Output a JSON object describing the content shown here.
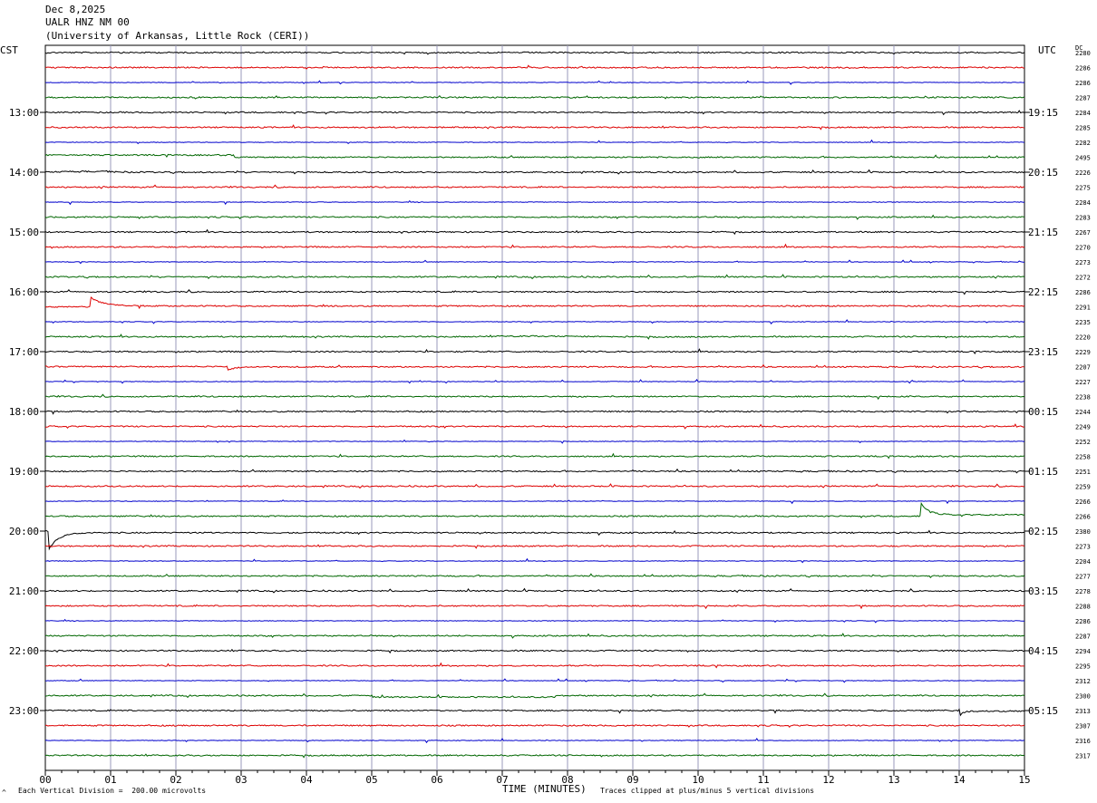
{
  "header": {
    "date": "Dec 8,2025",
    "station": "UALR HNZ NM 00",
    "institution": "(University of Arkansas, Little Rock (CERI))"
  },
  "labels": {
    "left_tz": "CST",
    "right_tz": "UTC",
    "dc_label": "DC",
    "xlabel": "TIME (MINUTES)",
    "scale_note": "Each Vertical Division =  200.00 microvolts",
    "clip_note": "Traces clipped at plus/minus 5 vertical divisions",
    "corner_mark": "^"
  },
  "colors": {
    "trace_cycle": [
      "#000000",
      "#dd0000",
      "#0000cc",
      "#006600"
    ],
    "grid_vertical": "#9999bb"
  },
  "chart_data": {
    "type": "line",
    "title": "",
    "x_range": [
      0,
      15
    ],
    "x_ticks": [
      "00",
      "01",
      "02",
      "03",
      "04",
      "05",
      "06",
      "07",
      "08",
      "09",
      "10",
      "11",
      "12",
      "13",
      "14",
      "15"
    ],
    "rows_per_hour": 4,
    "left_hour_labels": [
      "13:00",
      "14:00",
      "15:00",
      "16:00",
      "17:00",
      "18:00",
      "19:00",
      "20:00",
      "21:00",
      "22:00",
      "23:00"
    ],
    "right_hour_labels": [
      "19:15",
      "20:15",
      "21:15",
      "22:15",
      "23:15",
      "00:15",
      "01:15",
      "02:15",
      "03:15",
      "04:15",
      "05:15"
    ],
    "first_labeled_row": 4,
    "dc_values": [
      "2280",
      "2286",
      "2286",
      "2287",
      "2284",
      "2285",
      "2282",
      "2495",
      "2226",
      "2275",
      "2284",
      "2283",
      "2267",
      "2270",
      "2273",
      "2272",
      "2286",
      "2291",
      "2235",
      "2220",
      "2229",
      "2207",
      "2227",
      "2238",
      "2244",
      "2249",
      "2252",
      "2258",
      "2251",
      "2259",
      "2266",
      "2266",
      "2380",
      "2273",
      "2204",
      "2277",
      "2278",
      "2288",
      "2286",
      "2287",
      "2294",
      "2295",
      "2312",
      "2300",
      "2313",
      "2307",
      "2316",
      "2317"
    ],
    "events": [
      {
        "row": 7,
        "shape": "step",
        "start_min": 0.0,
        "end_min": 2.9,
        "amp_div": 0.6
      },
      {
        "row": 8,
        "shape": "bump",
        "start_min": 0.0,
        "end_min": 1.3,
        "amp_div": 0.2
      },
      {
        "row": 17,
        "shape": "spike",
        "start_min": 0.7,
        "end_min": 2.5,
        "amp_div": 0.9
      },
      {
        "row": 19,
        "shape": "wave",
        "start_min": 6.5,
        "end_min": 11.0,
        "amp_div": 0.2
      },
      {
        "row": 21,
        "shape": "spike",
        "start_min": 2.8,
        "end_min": 4.0,
        "amp_div": -0.3
      },
      {
        "row": 31,
        "shape": "spike",
        "start_min": 13.4,
        "end_min": 14.6,
        "amp_div": 1.4
      },
      {
        "row": 32,
        "shape": "spike",
        "start_min": 0.05,
        "end_min": 1.5,
        "amp_div": -1.8
      },
      {
        "row": 43,
        "shape": "step",
        "start_min": 5.0,
        "end_min": 7.8,
        "amp_div": -0.4
      },
      {
        "row": 44,
        "shape": "spike",
        "start_min": 14.0,
        "end_min": 14.5,
        "amp_div": -0.6
      }
    ]
  }
}
